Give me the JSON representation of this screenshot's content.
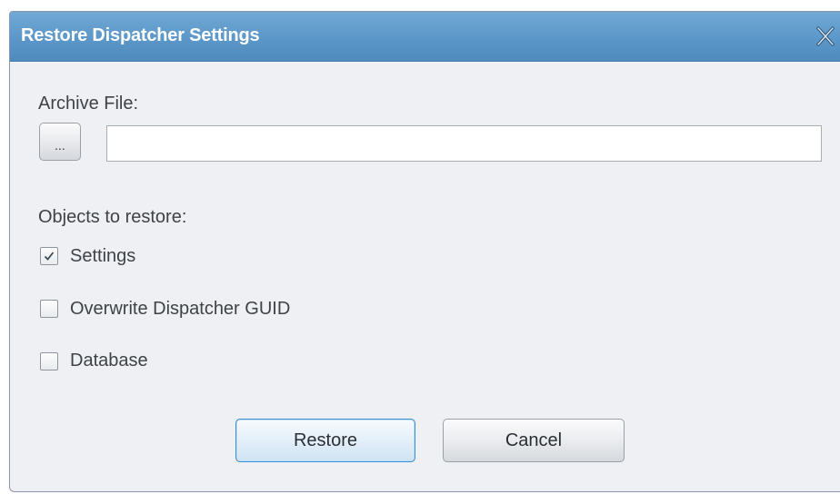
{
  "dialog": {
    "title": "Restore Dispatcher Settings",
    "close_icon": "close-icon"
  },
  "archive": {
    "label": "Archive File:",
    "browse_label": "...",
    "file_value": "",
    "file_placeholder": ""
  },
  "objects": {
    "label": "Objects to restore:",
    "items": [
      {
        "label": "Settings",
        "checked": true
      },
      {
        "label": "Overwrite Dispatcher GUID",
        "checked": false
      },
      {
        "label": "Database",
        "checked": false
      }
    ]
  },
  "buttons": {
    "restore": "Restore",
    "cancel": "Cancel"
  },
  "colors": {
    "titlebar": "#5b97c8",
    "dialog_bg": "#eef0f3",
    "primary_border": "#3c8fd0"
  }
}
